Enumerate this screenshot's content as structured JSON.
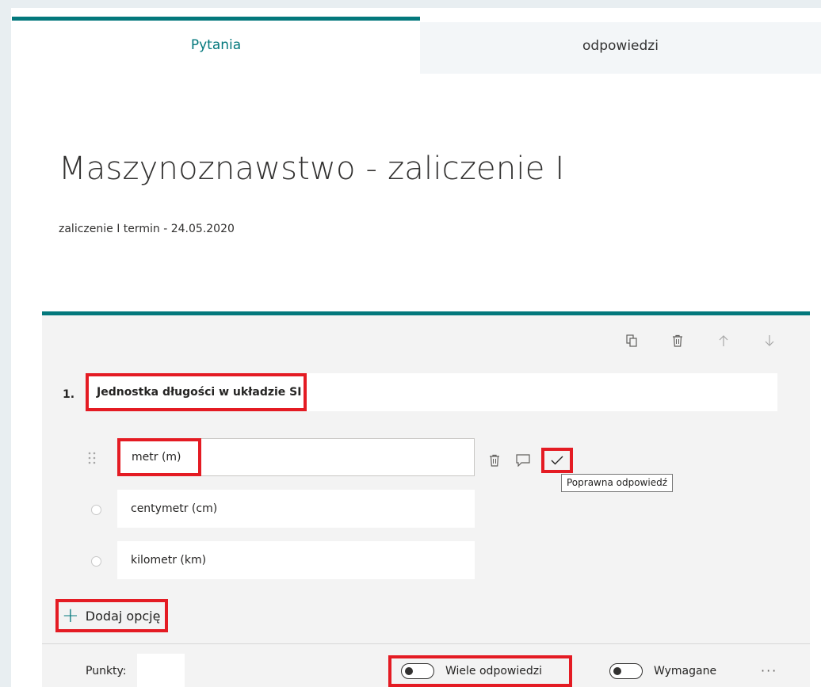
{
  "tabs": {
    "questions": "Pytania",
    "responses": "odpowiedzi"
  },
  "form": {
    "title": "Maszynoznawstwo - zaliczenie I",
    "subtitle": "zaliczenie I termin - 24.05.2020"
  },
  "question": {
    "number": "1.",
    "title": "Jednostka długości w układzie SI",
    "options": [
      {
        "label": "metr (m)",
        "correct": true
      },
      {
        "label": "centymetr (cm)",
        "correct": false
      },
      {
        "label": "kilometr (km)",
        "correct": false
      }
    ],
    "tooltip": "Poprawna odpowiedź",
    "add_option": "Dodaj opcję",
    "points_label": "Punkty:",
    "points_value": "",
    "multiple_answers_label": "Wiele odpowiedzi",
    "multiple_answers_on": false,
    "required_label": "Wymagane",
    "required_on": false,
    "more": "···"
  },
  "icons": {
    "toolbar": [
      "copy-icon",
      "delete-icon",
      "move-up-icon",
      "move-down-icon"
    ],
    "option_actions": [
      "delete-icon",
      "comment-icon",
      "checkmark-icon"
    ],
    "add_option": "plus-icon",
    "drag": "drag-handle-icon"
  },
  "colors": {
    "accent": "#03787c",
    "highlight": "#e41b23",
    "card_bg": "#f3f3f3"
  }
}
